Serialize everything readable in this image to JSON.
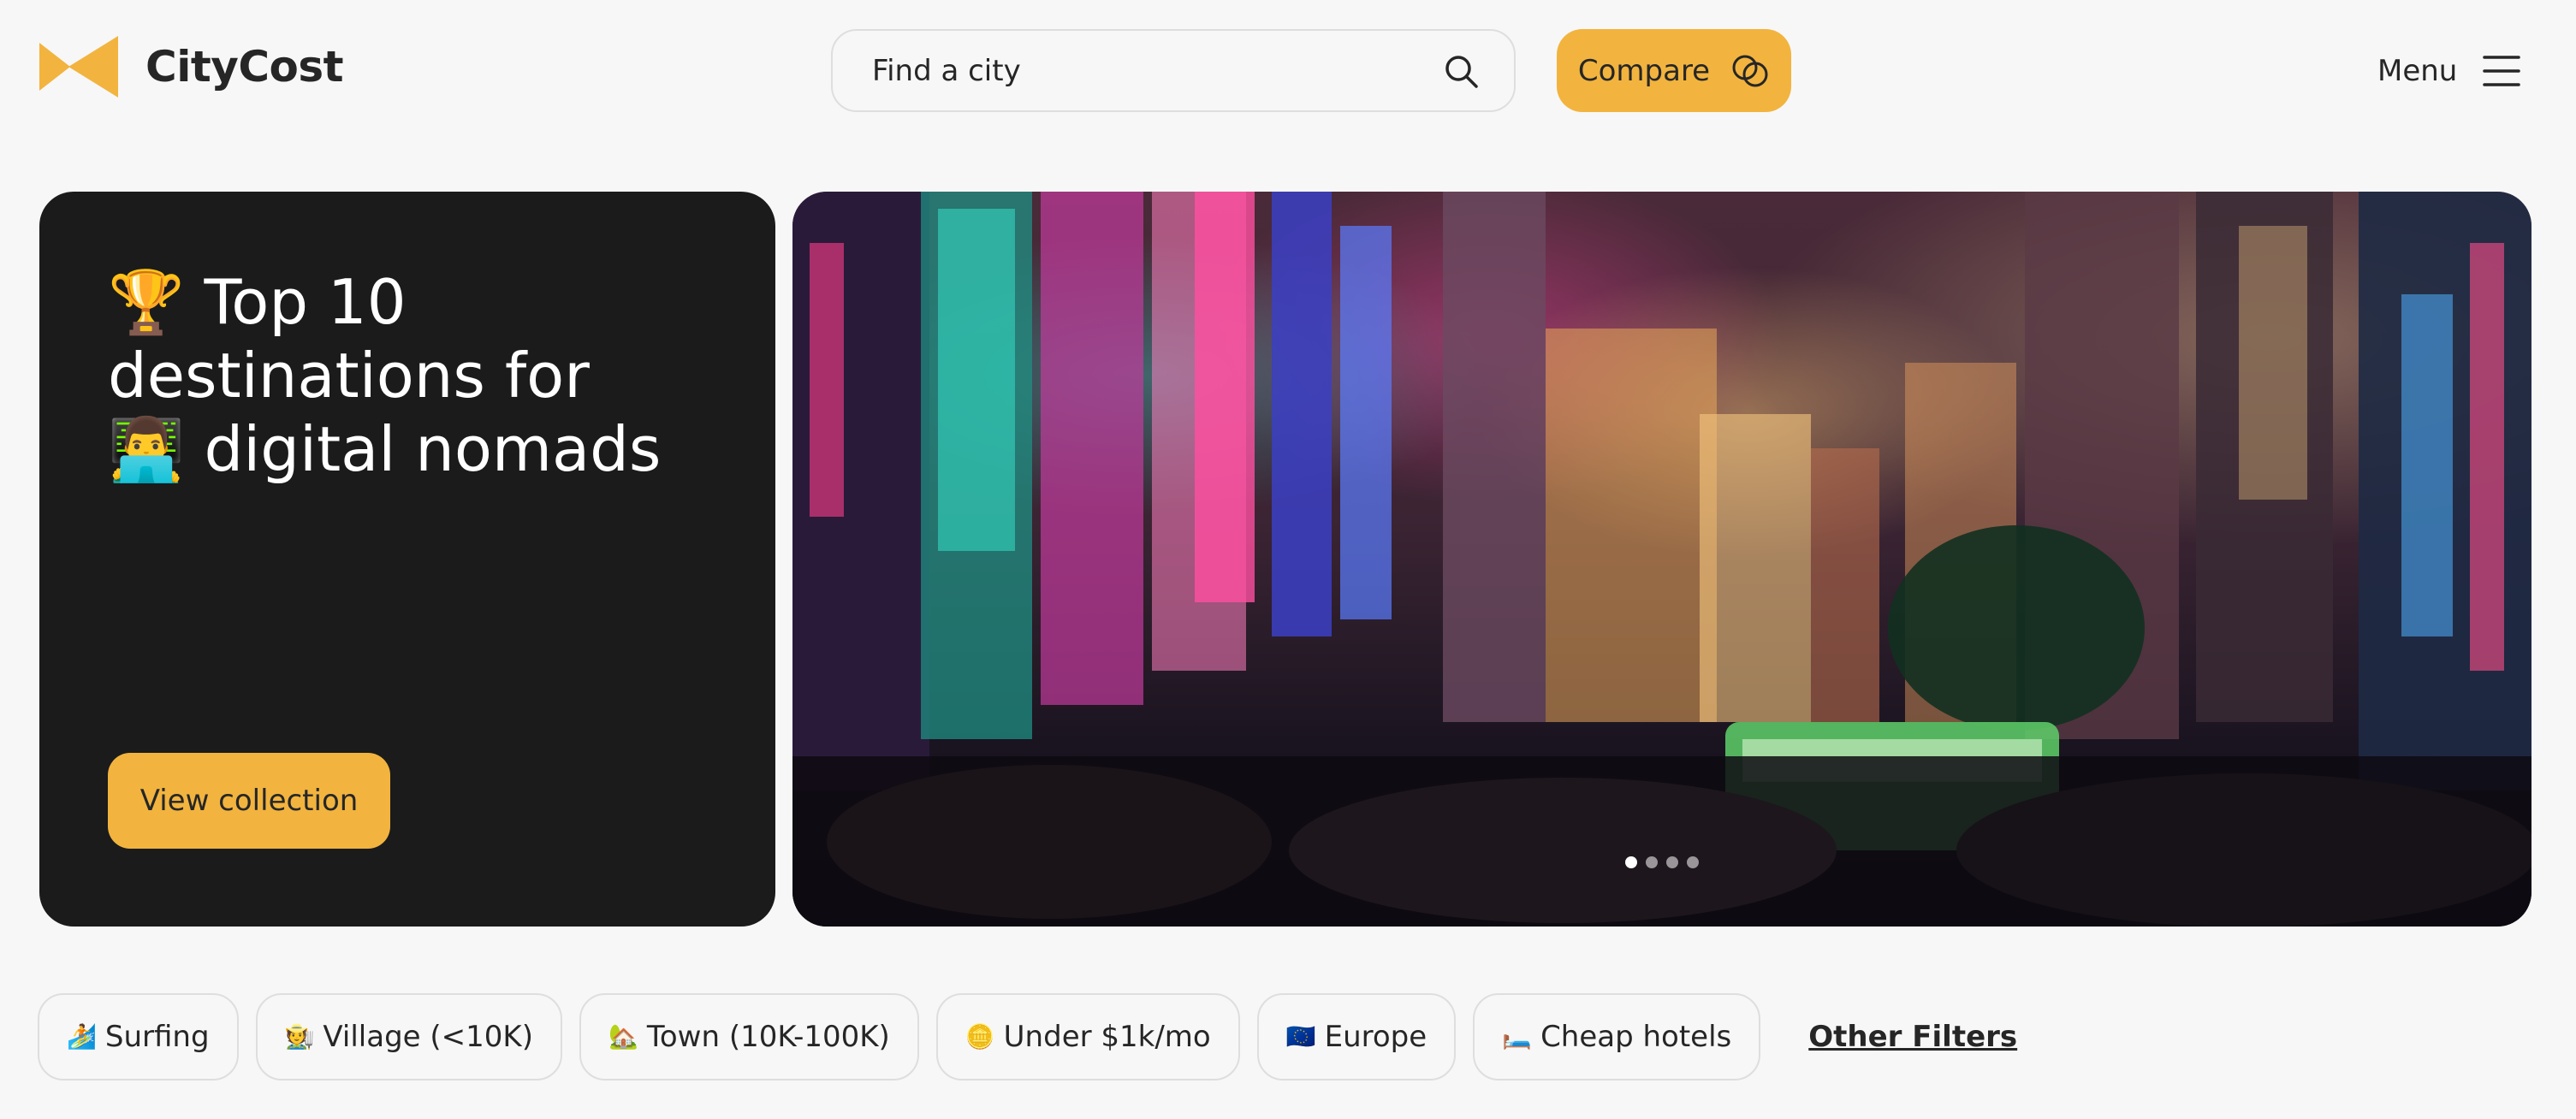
{
  "header": {
    "brand": "CityCost",
    "search_placeholder": "Find a city",
    "compare_label": "Compare",
    "menu_label": "Menu"
  },
  "colors": {
    "accent": "#f2b43f",
    "card": "#1b1b1b",
    "background": "#f7f7f7",
    "text": "#262626"
  },
  "hero": {
    "title_line1": "🏆 Top 10",
    "title_line2": "destinations for",
    "title_line3": "👨‍💻 digital nomads",
    "cta_label": "View collection",
    "carousel_slide_count": 4,
    "carousel_active_index": 0
  },
  "filters": {
    "chips": [
      {
        "icon": "🏄",
        "label": "Surfing"
      },
      {
        "icon": "🧑‍🌾",
        "label": "Village (<10K)"
      },
      {
        "icon": "🏡",
        "label": "Town (10K-100K)"
      },
      {
        "icon": "🪙",
        "label": "Under $1k/mo"
      },
      {
        "icon": "🇪🇺",
        "label": "Europe"
      },
      {
        "icon": "🛏️",
        "label": "Cheap hotels"
      }
    ],
    "other_label": "Other Filters"
  }
}
